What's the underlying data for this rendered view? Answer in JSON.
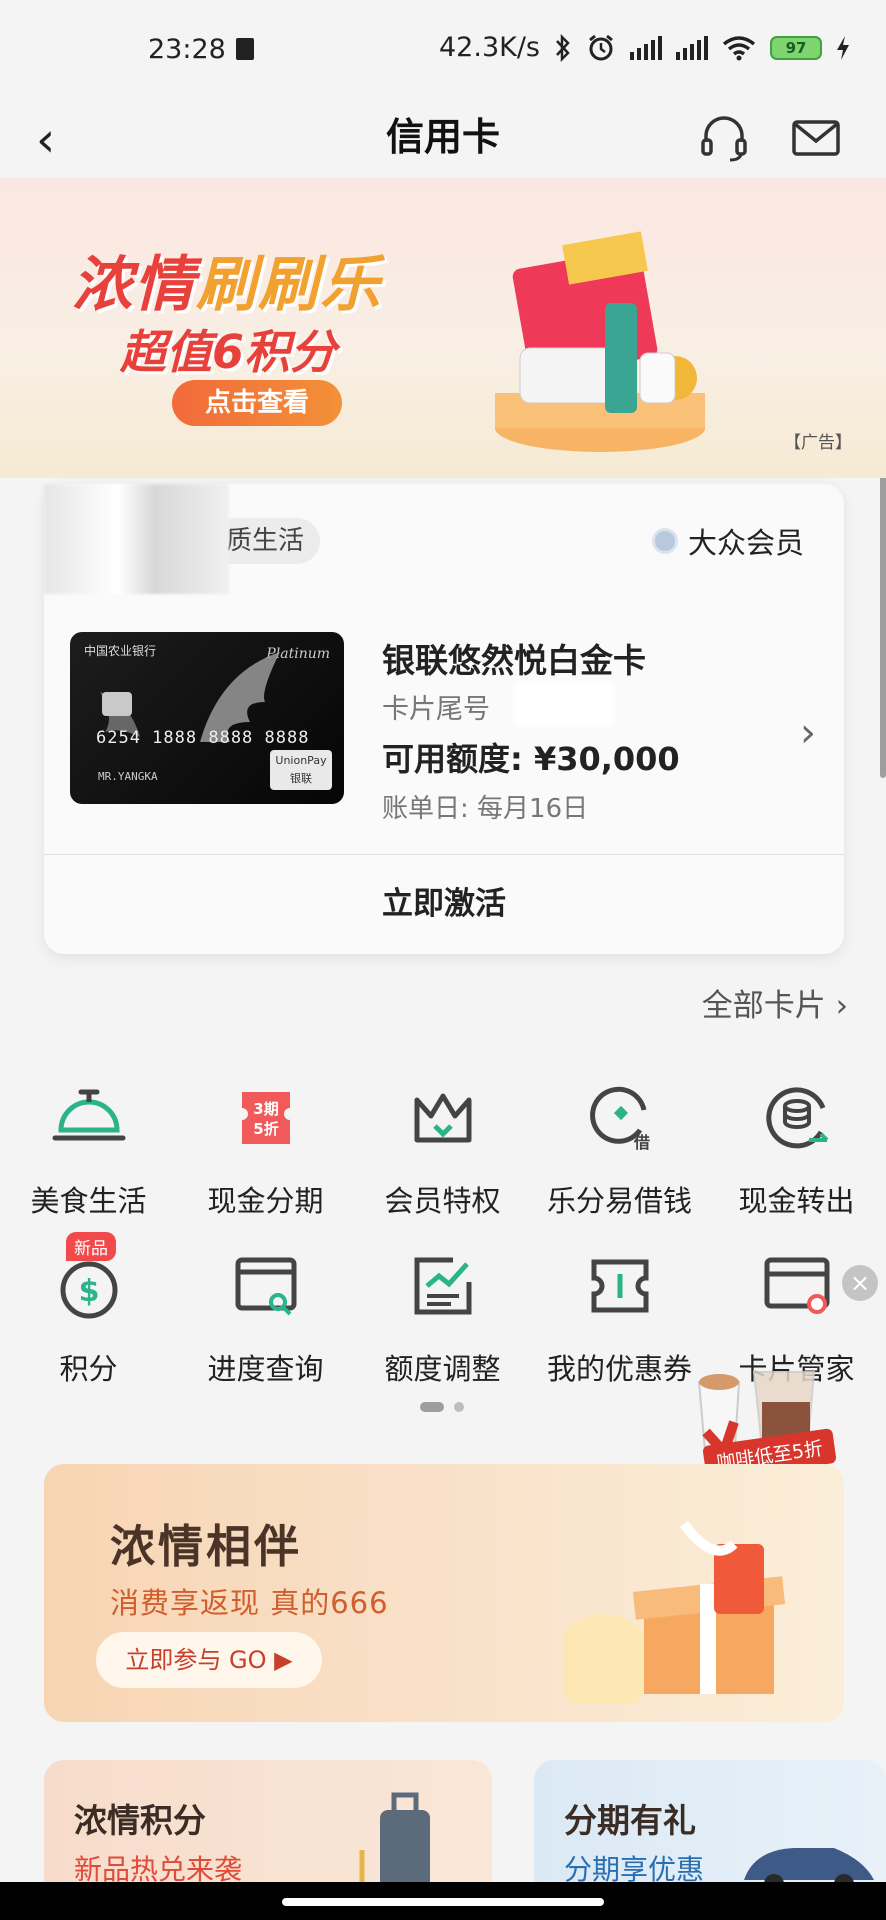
{
  "status_bar": {
    "time": "23:28",
    "network_speed": "42.3K/s",
    "battery": "97",
    "icons": [
      "trash-icon",
      "bluetooth-icon",
      "alarm-icon",
      "signal-icon",
      "hd-signal-icon",
      "wifi-icon",
      "battery-icon",
      "charging-icon"
    ]
  },
  "header": {
    "back_label": "‹",
    "title": "信用卡",
    "icons": [
      "headset-icon",
      "mail-icon"
    ]
  },
  "banner": {
    "title_part1": "浓情",
    "title_part2": "刷刷乐",
    "subtitle": "超值6积分",
    "button": "点击查看",
    "ad_label": "【广告】"
  },
  "card_panel": {
    "member_tag": "质生活",
    "member_level": "大众会员",
    "card": {
      "bank_name": "中国农业银行",
      "tier": "Platinum",
      "number": "6254 1888 8888 8888",
      "holder": "MR.YANGKA",
      "network": "UnionPay 银联",
      "name": "银联悠然悦白金卡",
      "tail_label": "卡片尾号",
      "limit": "可用额度: ¥30,000",
      "bill_day": "账单日: 每月16日"
    },
    "activate_button": "立即激活"
  },
  "all_cards": "全部卡片 ›",
  "grid": {
    "row1": [
      {
        "label": "美食生活",
        "icon": "food-cloche-icon"
      },
      {
        "label": "现金分期",
        "icon": "installment-ticket-icon"
      },
      {
        "label": "会员特权",
        "icon": "crown-icon"
      },
      {
        "label": "乐分易借钱",
        "icon": "loan-icon"
      },
      {
        "label": "现金转出",
        "icon": "cash-transfer-icon"
      }
    ],
    "row2": [
      {
        "label": "积分",
        "icon": "points-icon",
        "badge": "新品"
      },
      {
        "label": "进度查询",
        "icon": "progress-search-icon"
      },
      {
        "label": "额度调整",
        "icon": "limit-adjust-icon"
      },
      {
        "label": "我的优惠券",
        "icon": "coupon-icon"
      },
      {
        "label": "卡片管家",
        "icon": "card-manager-icon"
      }
    ],
    "installment_badge_top": "3期",
    "installment_badge_bottom": "5折",
    "loan_badge": "借"
  },
  "floating_ad": {
    "tag": "咖啡低至5折",
    "close": "×"
  },
  "promo": {
    "title": "浓情相伴",
    "subtitle": "消费享返现 真的666",
    "button": "立即参与 GO ▶"
  },
  "mini_cards": [
    {
      "title": "浓情积分",
      "subtitle": "新品热兑来袭"
    },
    {
      "title": "分期有礼",
      "subtitle": "分期享优惠"
    }
  ],
  "colors": {
    "accent_red": "#e8413c",
    "accent_green": "#2bb38a",
    "badge_red": "#f24a4a"
  }
}
